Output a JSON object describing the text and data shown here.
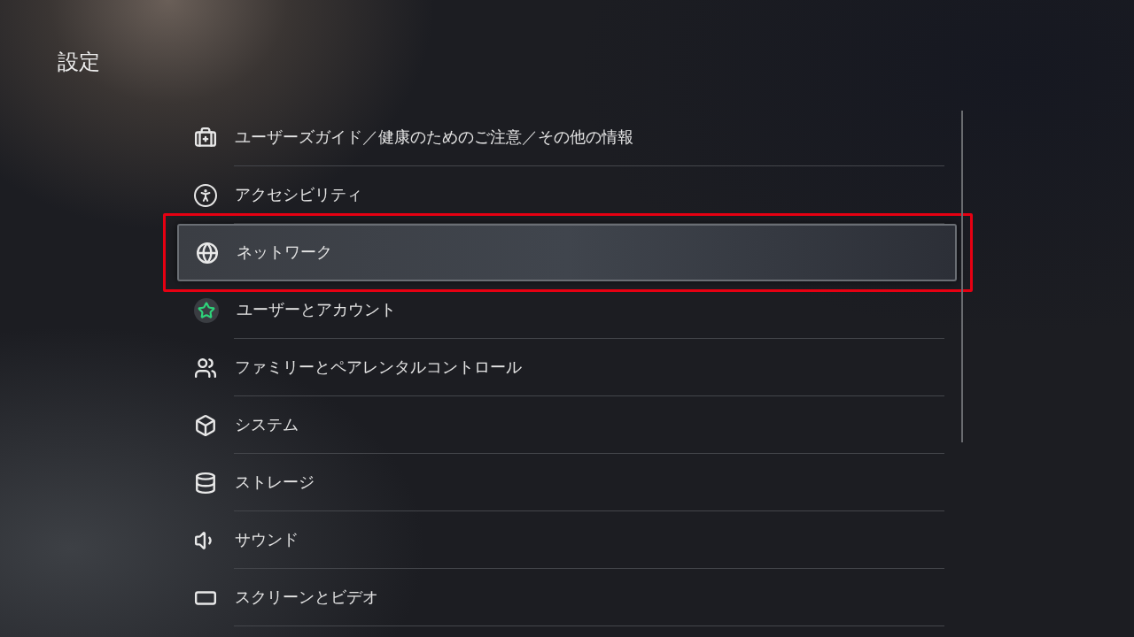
{
  "title": "設定",
  "items": [
    {
      "label": "ユーザーズガイド／健康のためのご注意／その他の情報",
      "kind": "guide",
      "selected": false
    },
    {
      "label": "アクセシビリティ",
      "kind": "accessibility",
      "selected": false
    },
    {
      "label": "ネットワーク",
      "kind": "network",
      "selected": true
    },
    {
      "label": "ユーザーとアカウント",
      "kind": "users",
      "selected": false
    },
    {
      "label": "ファミリーとペアレンタルコントロール",
      "kind": "family",
      "selected": false
    },
    {
      "label": "システム",
      "kind": "system",
      "selected": false
    },
    {
      "label": "ストレージ",
      "kind": "storage",
      "selected": false
    },
    {
      "label": "サウンド",
      "kind": "sound",
      "selected": false
    },
    {
      "label": "スクリーンとビデオ",
      "kind": "screen",
      "selected": false
    }
  ]
}
